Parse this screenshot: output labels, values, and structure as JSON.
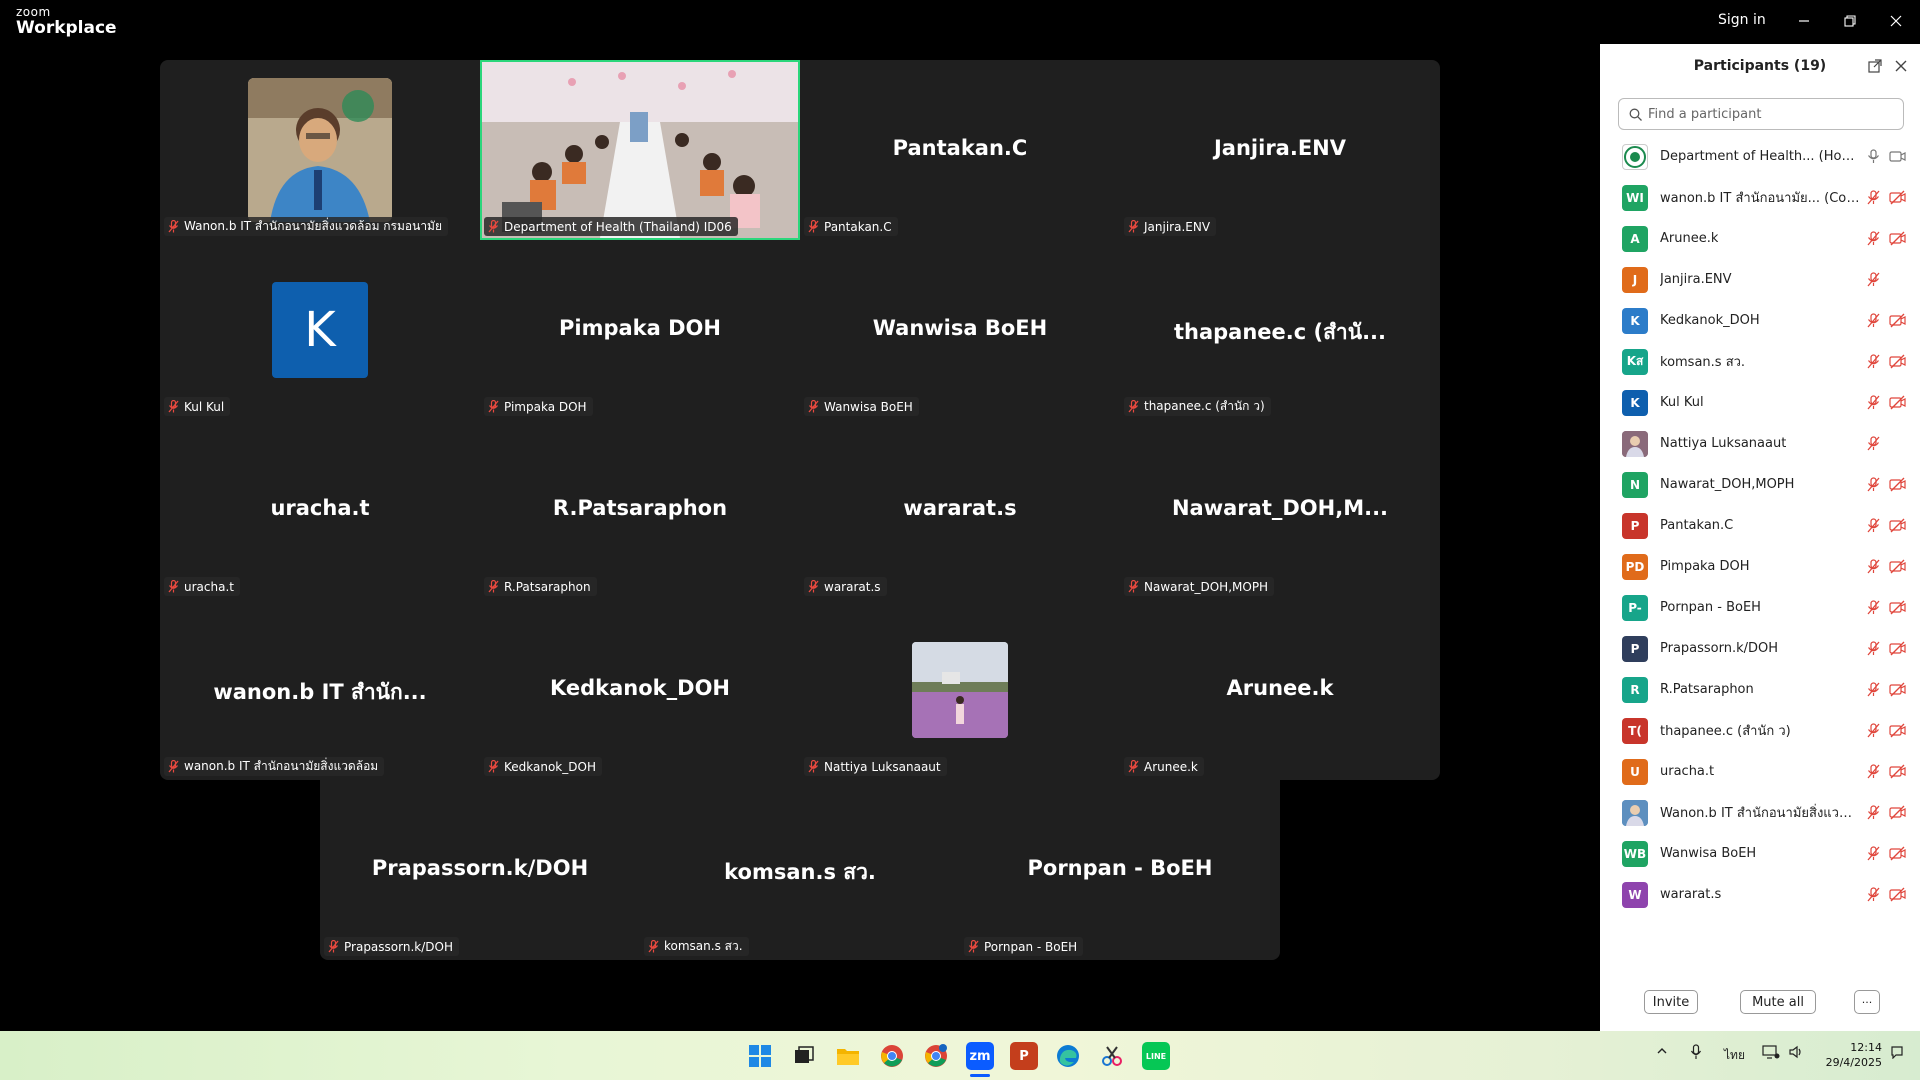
{
  "app": {
    "brand_top": "zoom",
    "brand_bottom": "Workplace",
    "sign_in": "Sign in"
  },
  "grid_tiles": [
    {
      "big": "",
      "label": "Wanon.b IT สำนักอนามัยสิ่งแวดล้อม กรมอนามัย",
      "kind": "photo"
    },
    {
      "big": "",
      "label": "Department of Health (Thailand) ID06",
      "kind": "room"
    },
    {
      "big": "Pantakan.C",
      "label": "Pantakan.C"
    },
    {
      "big": "Janjira.ENV",
      "label": "Janjira.ENV"
    },
    {
      "big": "",
      "label": "Kul Kul",
      "kind": "avatar",
      "avatar_letter": "K"
    },
    {
      "big": "Pimpaka DOH",
      "label": "Pimpaka DOH"
    },
    {
      "big": "Wanwisa BoEH",
      "label": "Wanwisa BoEH"
    },
    {
      "big": "thapanee.c (สำนั...",
      "label": "thapanee.c (สำนัก ว)"
    },
    {
      "big": "uracha.t",
      "label": "uracha.t"
    },
    {
      "big": "R.Patsaraphon",
      "label": "R.Patsaraphon"
    },
    {
      "big": "wararat.s",
      "label": "wararat.s"
    },
    {
      "big": "Nawarat_DOH,M...",
      "label": "Nawarat_DOH,MOPH"
    },
    {
      "big": "wanon.b  IT สำนัก...",
      "label": "wanon.b IT สำนักอนามัยสิ่งแวดล้อม"
    },
    {
      "big": "Kedkanok_DOH",
      "label": "Kedkanok_DOH"
    },
    {
      "big": "",
      "label": "Nattiya Luksanaaut",
      "kind": "flowers"
    },
    {
      "big": "Arunee.k",
      "label": "Arunee.k"
    }
  ],
  "bottom_tiles": [
    {
      "big": "Prapassorn.k/DOH",
      "label": "Prapassorn.k/DOH"
    },
    {
      "big": "komsan.s สว.",
      "label": "komsan.s สว."
    },
    {
      "big": "Pornpan - BoEH",
      "label": "Pornpan - BoEH"
    }
  ],
  "panel": {
    "title": "Participants (19)",
    "search_placeholder": "Find a participant",
    "participants": [
      {
        "initials": "",
        "name": "Department of Health... (Host, me)",
        "color": "#ffffff",
        "kind": "logo",
        "mic": "on",
        "video": "on"
      },
      {
        "initials": "WI",
        "name": "wanon.b IT สำนักอนามัย... (Co-host)",
        "color": "#1fa463",
        "mic": "off",
        "video": "off"
      },
      {
        "initials": "A",
        "name": "Arunee.k",
        "color": "#1fa463",
        "mic": "off",
        "video": "off"
      },
      {
        "initials": "J",
        "name": "Janjira.ENV",
        "color": "#e06b1a",
        "mic": "off",
        "video": "none"
      },
      {
        "initials": "K",
        "name": "Kedkanok_DOH",
        "color": "#2c7cc9",
        "mic": "off",
        "video": "off"
      },
      {
        "initials": "Kส",
        "name": "komsan.s สว.",
        "color": "#17a58a",
        "mic": "off",
        "video": "off"
      },
      {
        "initials": "K",
        "name": "Kul Kul",
        "color": "#0e5fae",
        "mic": "off",
        "video": "off"
      },
      {
        "initials": "",
        "name": "Nattiya Luksanaaut",
        "color": "#8a6a7a",
        "kind": "photo",
        "mic": "off",
        "video": "none"
      },
      {
        "initials": "N",
        "name": "Nawarat_DOH,MOPH",
        "color": "#1fa463",
        "mic": "off",
        "video": "off"
      },
      {
        "initials": "P",
        "name": "Pantakan.C",
        "color": "#c8352b",
        "mic": "off",
        "video": "off"
      },
      {
        "initials": "PD",
        "name": "Pimpaka DOH",
        "color": "#e06b1a",
        "mic": "off",
        "video": "off"
      },
      {
        "initials": "P-",
        "name": "Pornpan - BoEH",
        "color": "#17a58a",
        "mic": "off",
        "video": "off"
      },
      {
        "initials": "P",
        "name": "Prapassorn.k/DOH",
        "color": "#2f3e5c",
        "mic": "off",
        "video": "off"
      },
      {
        "initials": "R",
        "name": "R.Patsaraphon",
        "color": "#17a58a",
        "mic": "off",
        "video": "off"
      },
      {
        "initials": "T(",
        "name": "thapanee.c (สำนัก ว)",
        "color": "#c8352b",
        "mic": "off",
        "video": "off"
      },
      {
        "initials": "U",
        "name": "uracha.t",
        "color": "#e06b1a",
        "mic": "off",
        "video": "off"
      },
      {
        "initials": "",
        "name": "Wanon.b IT สำนักอนามัยสิ่งแวดล้อม ...",
        "color": "#5d8fbf",
        "kind": "photo",
        "mic": "off",
        "video": "off"
      },
      {
        "initials": "WB",
        "name": "Wanwisa BoEH",
        "color": "#1fa463",
        "mic": "off",
        "video": "off"
      },
      {
        "initials": "W",
        "name": "wararat.s",
        "color": "#8e44ad",
        "mic": "off",
        "video": "off"
      }
    ],
    "invite_label": "Invite",
    "mute_all_label": "Mute all",
    "more_label": "···"
  },
  "taskbar": {
    "apps": [
      {
        "name": "windows-start",
        "label": ""
      },
      {
        "name": "task-view",
        "label": ""
      },
      {
        "name": "file-explorer",
        "label": ""
      },
      {
        "name": "chrome",
        "label": ""
      },
      {
        "name": "chrome-profile",
        "label": ""
      },
      {
        "name": "zoom",
        "label": "zm"
      },
      {
        "name": "powerpoint",
        "label": "P"
      },
      {
        "name": "edge",
        "label": ""
      },
      {
        "name": "snipping-tool",
        "label": ""
      },
      {
        "name": "line",
        "label": "LINE"
      }
    ],
    "language": "ไทย",
    "time": "12:14",
    "date": "29/4/2025"
  }
}
